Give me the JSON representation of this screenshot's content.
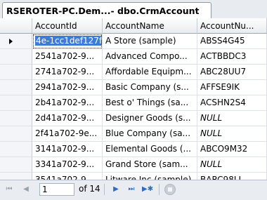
{
  "tab": {
    "title": "RSEROTER-PC.Dem...- dbo.CrmAccount"
  },
  "grid": {
    "columns": [
      "AccountId",
      "AccountName",
      "AccountNu..."
    ],
    "rows": [
      {
        "id": "4e-1cc1def127f4",
        "name": "A Store (sample)",
        "number": "ABSS4G45",
        "current": true
      },
      {
        "id": "2541a702-9...",
        "name": "Advanced Compo...",
        "number": "ACTBBDC3"
      },
      {
        "id": "2741a702-9...",
        "name": "Affordable Equipm...",
        "number": "ABC28UU7"
      },
      {
        "id": "2941a702-9...",
        "name": "Basic Company (s...",
        "number": "AFFSE9IK"
      },
      {
        "id": "2b41a702-9...",
        "name": "Best o' Things (sa...",
        "number": "ACSHN2S4"
      },
      {
        "id": "2d41a702-9...",
        "name": "Designer Goods (s...",
        "number": "NULL"
      },
      {
        "id": "2f41a702-9e...",
        "name": "Blue Company (sa...",
        "number": "NULL"
      },
      {
        "id": "3141a702-9...",
        "name": "Elemental Goods (...",
        "number": "ABCO9M32"
      },
      {
        "id": "3341a702-9...",
        "name": "Grand Store (sam...",
        "number": "NULL"
      },
      {
        "id": "3541a702-9",
        "name": "Litware Inc (sample)",
        "number": "BARC98LL"
      }
    ]
  },
  "navigator": {
    "current_page": "1",
    "total_label": "of 14",
    "icons": [
      "first-icon",
      "previous-icon",
      "next-icon",
      "last-icon",
      "new-row-icon",
      "stop-icon"
    ]
  }
}
